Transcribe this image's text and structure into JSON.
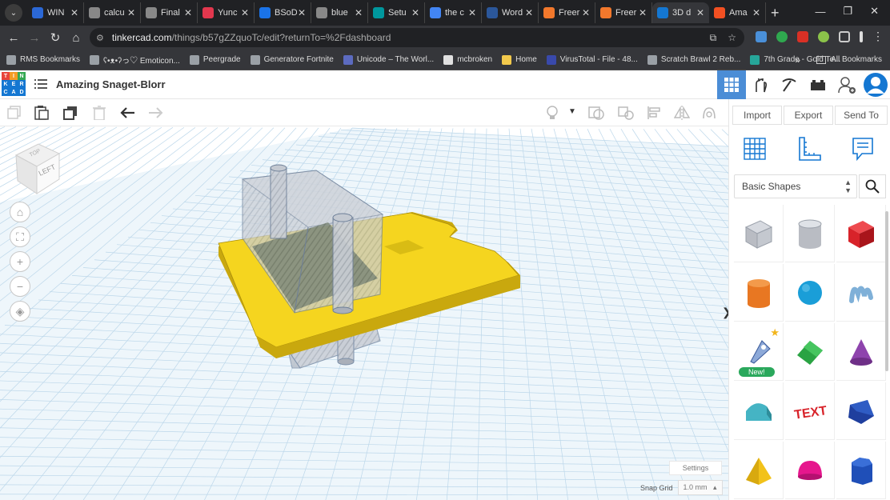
{
  "browser": {
    "tabs": [
      {
        "label": "WIN",
        "fav_color": "#2b68d6"
      },
      {
        "label": "calcu",
        "fav_color": "#888888"
      },
      {
        "label": "Final",
        "fav_color": "#888888"
      },
      {
        "label": "Yunc",
        "fav_color": "#e3374e"
      },
      {
        "label": "BSoD",
        "fav_color": "#1a73e8"
      },
      {
        "label": "blue",
        "fav_color": "#888888"
      },
      {
        "label": "Setu",
        "fav_color": "#00979d"
      },
      {
        "label": "the c",
        "fav_color": "#4285f4"
      },
      {
        "label": "Word",
        "fav_color": "#2b579a"
      },
      {
        "label": "Freer",
        "fav_color": "#f2782c"
      },
      {
        "label": "Freer",
        "fav_color": "#f2782c"
      },
      {
        "label": "3D d",
        "fav_color": "#1477d2"
      },
      {
        "label": "Ama",
        "fav_color": "#f25022"
      }
    ],
    "url_domain": "tinkercad.com",
    "url_path": "/things/b57gZZquoTc/edit?returnTo=%2Fdashboard",
    "bookmarks": [
      {
        "label": "RMS Bookmarks",
        "color": "#9aa0a6"
      },
      {
        "label": "ʕ•ᴥ•ʔっ♡ Emoticon...",
        "color": "#9aa0a6"
      },
      {
        "label": "Peergrade",
        "color": "#9aa0a6"
      },
      {
        "label": "Generatore Fortnite",
        "color": "#9aa0a6"
      },
      {
        "label": "Unicode – The Worl...",
        "color": "#5c6bc0"
      },
      {
        "label": "mcbroken",
        "color": "#e0e0e0"
      },
      {
        "label": "Home",
        "color": "#f2c94c"
      },
      {
        "label": "VirusTotal - File - 48...",
        "color": "#3949ab"
      },
      {
        "label": "Scratch Brawl 2 Reb...",
        "color": "#9aa0a6"
      },
      {
        "label": "7th Grade - Gold Te...",
        "color": "#26a69a"
      }
    ],
    "all_bookmarks": "All Bookmarks"
  },
  "app": {
    "logo_letters": [
      "T",
      "I",
      "N",
      "K",
      "E",
      "R",
      "C",
      "A",
      "D"
    ],
    "logo_colors": [
      "#e8443a",
      "#f39c25",
      "#35a852",
      "#1477d2",
      "#1477d2",
      "#1477d2",
      "#1477d2",
      "#1477d2",
      "#1477d2"
    ],
    "project_title": "Amazing Snaget-Blorr"
  },
  "panel": {
    "import": "Import",
    "export": "Export",
    "send_to": "Send To",
    "category": "Basic Shapes",
    "new_badge": "New!",
    "shapes": [
      {
        "name": "box-hole",
        "color": "#b9bcc3"
      },
      {
        "name": "cylinder-hole",
        "color": "#b9bcc3"
      },
      {
        "name": "box",
        "color": "#d8232a"
      },
      {
        "name": "cylinder",
        "color": "#e87722"
      },
      {
        "name": "sphere",
        "color": "#1a9ed8"
      },
      {
        "name": "scribble",
        "color": "#7fb0d8"
      },
      {
        "name": "shape-generator",
        "color": "#8da9d8"
      },
      {
        "name": "roof",
        "color": "#2aa343"
      },
      {
        "name": "cone",
        "color": "#8e44ad"
      },
      {
        "name": "round-roof",
        "color": "#45b4c4"
      },
      {
        "name": "text",
        "color": "#d8232a"
      },
      {
        "name": "polygon",
        "color": "#1f3f9e"
      },
      {
        "name": "pyramid",
        "color": "#f2c21a"
      },
      {
        "name": "half-sphere",
        "color": "#e6168d"
      },
      {
        "name": "hex-prism",
        "color": "#1f4fb8"
      }
    ]
  },
  "viewport": {
    "view_cube_label": "LEFT",
    "settings": "Settings",
    "snap_label": "Snap Grid",
    "snap_value": "1.0 mm"
  }
}
